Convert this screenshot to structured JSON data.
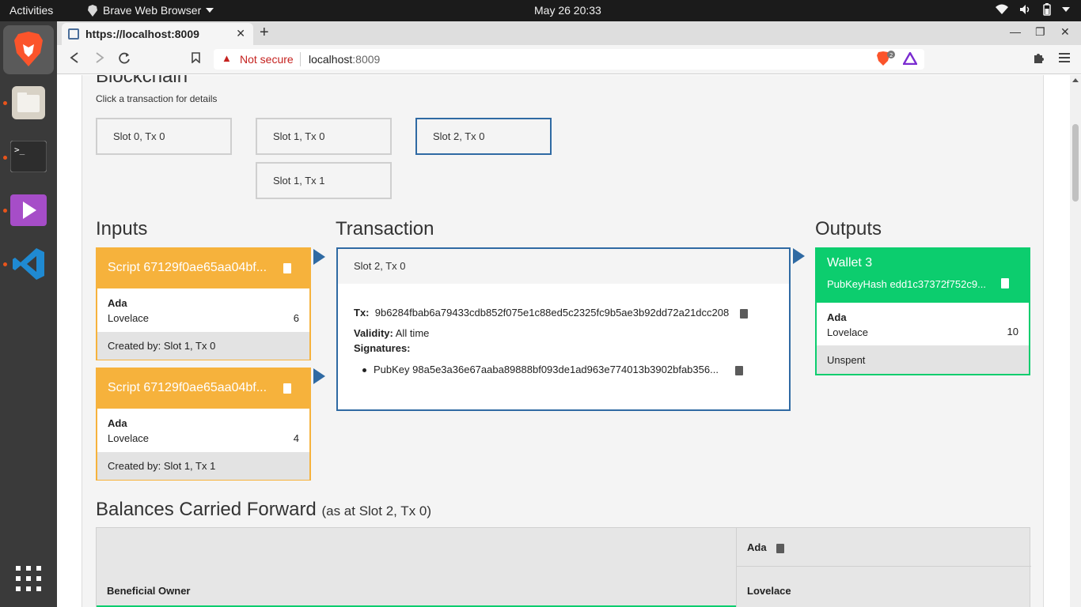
{
  "system": {
    "activities": "Activities",
    "app_name": "Brave Web Browser",
    "clock": "May 26  20:33"
  },
  "browser": {
    "tab_title": "https://localhost:8009",
    "security_label": "Not secure",
    "url_host": "localhost",
    "url_port": ":8009",
    "shields_count": "2"
  },
  "blockchain": {
    "title": "Blockchain",
    "hint": "Click a transaction for details",
    "transactions": [
      {
        "label": "Slot 0, Tx 0",
        "selected": false
      },
      {
        "label": "Slot 1, Tx 0",
        "selected": false
      },
      {
        "label": "Slot 2, Tx 0",
        "selected": true
      },
      {
        "label": "Slot 1, Tx 1",
        "selected": false
      }
    ]
  },
  "inputs": {
    "title": "Inputs",
    "items": [
      {
        "header": "Script 67129f0ae65aa04bf...",
        "currency": "Ada",
        "unit": "Lovelace",
        "amount": "6",
        "created_by": "Created by: Slot 1, Tx 0"
      },
      {
        "header": "Script 67129f0ae65aa04bf...",
        "currency": "Ada",
        "unit": "Lovelace",
        "amount": "4",
        "created_by": "Created by: Slot 1, Tx 1"
      }
    ]
  },
  "transaction": {
    "title": "Transaction",
    "slot_label": "Slot 2, Tx 0",
    "tx_label": "Tx:",
    "tx_hash": "9b6284fbab6a79433cdb852f075e1c88ed5c2325fc9b5ae3b92dd72a21dcc208",
    "validity_label": "Validity:",
    "validity_value": "All time",
    "signatures_label": "Signatures:",
    "signatures": [
      "PubKey 98a5e3a36e67aaba89888bf093de1ad963e774013b3902bfab356..."
    ]
  },
  "outputs": {
    "title": "Outputs",
    "items": [
      {
        "name": "Wallet 3",
        "pubkeyhash": "PubKeyHash edd1c37372f752c9...",
        "currency": "Ada",
        "unit": "Lovelace",
        "amount": "10",
        "status": "Unspent"
      }
    ]
  },
  "balances": {
    "title": "Balances Carried Forward",
    "subtitle": "(as at Slot 2, Tx 0)",
    "owner_header": "Beneficial Owner",
    "currency_header": "Ada",
    "unit_header": "Lovelace"
  },
  "colors": {
    "input_accent": "#f6b23c",
    "output_accent": "#0ccd6e",
    "selected_border": "#2f6aa3"
  }
}
